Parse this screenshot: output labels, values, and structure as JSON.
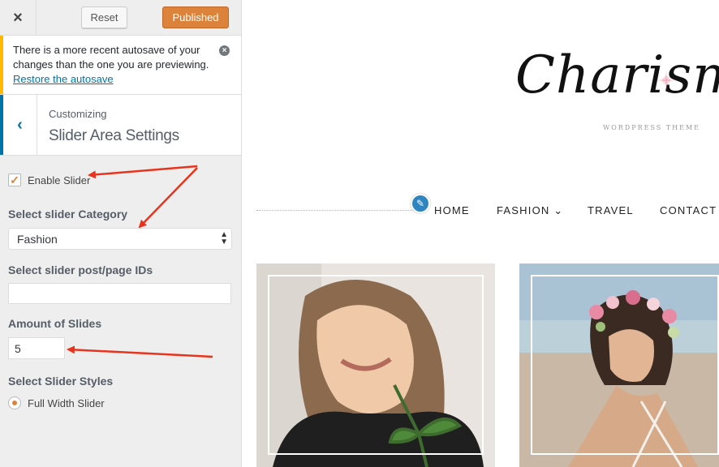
{
  "topbar": {
    "close_icon": "×",
    "reset_label": "Reset",
    "publish_label": "Published"
  },
  "notice": {
    "text": "There is a more recent autosave of your changes than the one you are previewing.",
    "link": "Restore the autosave",
    "dismiss_icon": "×"
  },
  "section": {
    "back_icon": "‹",
    "customizing": "Customizing",
    "title": "Slider Area Settings"
  },
  "controls": {
    "enable_slider": {
      "label": "Enable Slider",
      "checked": true,
      "check_icon": "✓"
    },
    "category": {
      "label": "Select slider Category",
      "value": "Fashion",
      "arrow_icon": "▴▾"
    },
    "ids": {
      "label": "Select slider post/page IDs",
      "value": ""
    },
    "amount": {
      "label": "Amount of Slides",
      "value": "5"
    },
    "styles": {
      "label": "Select Slider Styles",
      "option": "Full Width Slider",
      "selected": true
    }
  },
  "preview": {
    "logo": "Charism",
    "logo_sub": "WORDPRESS THEME",
    "edit_icon": "✎",
    "nav": [
      {
        "label": "HOME"
      },
      {
        "label": "FASHION ⌄"
      },
      {
        "label": "TRAVEL"
      },
      {
        "label": "CONTACT"
      }
    ]
  },
  "colors": {
    "accent": "#dd823b",
    "link": "#0073aa",
    "notice_border": "#ffb900",
    "annotation": "#e8341c"
  }
}
